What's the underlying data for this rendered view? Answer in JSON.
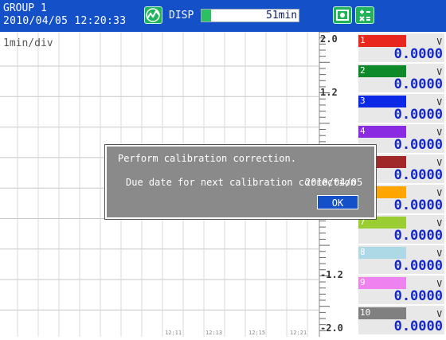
{
  "header": {
    "group_name": "GROUP 1",
    "datetime": "2010/04/05 12:20:33",
    "disp_label": "DISP",
    "memory_remaining": "51min",
    "memory_used_fraction": 0.1
  },
  "trend": {
    "timebase": "1min/div",
    "time_labels": [
      "12:11",
      "12:13",
      "12:15",
      "12:21"
    ]
  },
  "scale": {
    "top": "2.0",
    "upper": "1.2",
    "lower": "-1.2",
    "bottom": "-2.0"
  },
  "channels": [
    {
      "num": "1",
      "color": "#e8281e",
      "unit": "V",
      "value": "0.0000"
    },
    {
      "num": "2",
      "color": "#0e8a2a",
      "unit": "V",
      "value": "0.0000"
    },
    {
      "num": "3",
      "color": "#0a28e6",
      "unit": "V",
      "value": "0.0000"
    },
    {
      "num": "4",
      "color": "#8a2be2",
      "unit": "V",
      "value": "0.0000"
    },
    {
      "num": "5",
      "color": "#a02828",
      "unit": "V",
      "value": "0.0000"
    },
    {
      "num": "6",
      "color": "#ffa500",
      "unit": "V",
      "value": "0.0000"
    },
    {
      "num": "7",
      "color": "#9acd32",
      "unit": "V",
      "value": "0.0000"
    },
    {
      "num": "8",
      "color": "#add8e6",
      "unit": "V",
      "value": "0.0000"
    },
    {
      "num": "9",
      "color": "#ee82ee",
      "unit": "V",
      "value": "0.0000"
    },
    {
      "num": "10",
      "color": "#808080",
      "unit": "V",
      "value": "0.0000"
    }
  ],
  "dialog": {
    "message": "Perform calibration correction.",
    "due_label": "Due date for next calibration correction",
    "due_date": "2010/04/05",
    "ok_label": "OK"
  }
}
